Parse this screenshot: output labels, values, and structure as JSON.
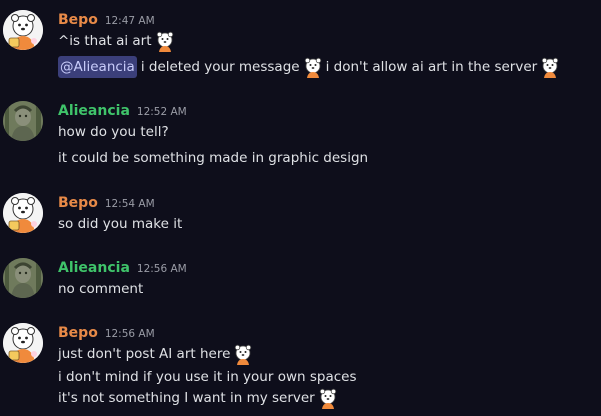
{
  "colors": {
    "background": "#0e0e1b",
    "bepo_name": "#e88a48",
    "alieancia_name": "#3fc36a",
    "mention_bg": "#3b3f7a",
    "mention_text": "#c9cdfb",
    "timestamp": "#9a9ca6",
    "message_text": "#dfe1e5"
  },
  "messages": [
    {
      "author": "Bepo",
      "time": "12:47 AM",
      "avatar": "bepo-avatar",
      "lines": [
        {
          "text": "^is that ai art",
          "trailing_emoji": "polar-bear-sticker"
        },
        {
          "mention": "@Alieancia",
          "text": "i deleted your message",
          "mid_emoji": "polar-bear-sticker",
          "text2": "i don't allow ai art in the server",
          "trailing_emoji": "polar-bear-sticker"
        }
      ]
    },
    {
      "author": "Alieancia",
      "time": "12:52 AM",
      "avatar": "alieancia-avatar",
      "lines": [
        {
          "text": "how do you tell?"
        },
        {
          "text": "it could be something made in graphic design"
        }
      ]
    },
    {
      "author": "Bepo",
      "time": "12:54 AM",
      "avatar": "bepo-avatar",
      "lines": [
        {
          "text": "so did you make it"
        }
      ]
    },
    {
      "author": "Alieancia",
      "time": "12:56 AM",
      "avatar": "alieancia-avatar",
      "lines": [
        {
          "text": "no comment"
        }
      ]
    },
    {
      "author": "Bepo",
      "time": "12:56 AM",
      "avatar": "bepo-avatar",
      "lines": [
        {
          "text": "just don't post AI art here",
          "trailing_emoji": "polar-bear-sticker"
        },
        {
          "text": "i don't mind if you use it in your own spaces"
        },
        {
          "text": "it's not something I want in my server",
          "trailing_emoji": "polar-bear-sticker"
        }
      ]
    }
  ]
}
